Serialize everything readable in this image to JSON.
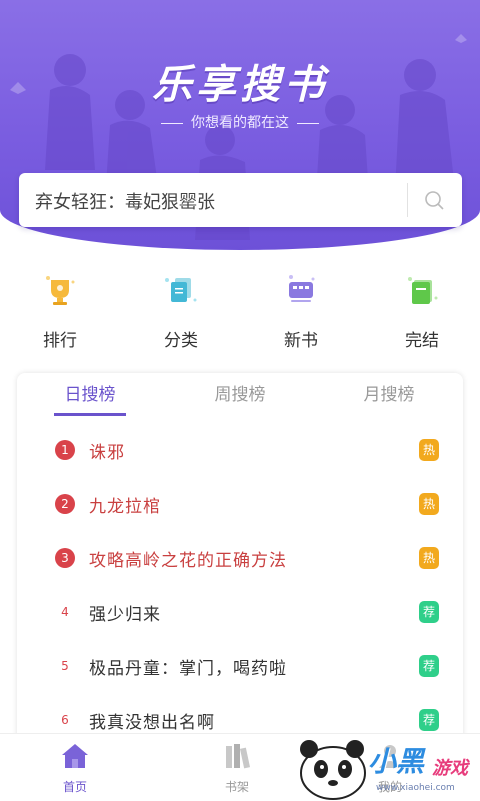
{
  "header": {
    "logo": "乐享搜书",
    "slogan": "你想看的都在这"
  },
  "search": {
    "placeholder": "弃女轻狂：毒妃狠罂张"
  },
  "categories": [
    {
      "label": "排行",
      "icon": "trophy-icon"
    },
    {
      "label": "分类",
      "icon": "category-icon"
    },
    {
      "label": "新书",
      "icon": "new-book-icon"
    },
    {
      "label": "完结",
      "icon": "finished-book-icon"
    }
  ],
  "tabs": [
    {
      "label": "日搜榜",
      "active": true
    },
    {
      "label": "周搜榜",
      "active": false
    },
    {
      "label": "月搜榜",
      "active": false
    }
  ],
  "rankings": [
    {
      "rank": "1",
      "title": "诛邪",
      "badge": "热"
    },
    {
      "rank": "2",
      "title": "九龙拉棺",
      "badge": "热"
    },
    {
      "rank": "3",
      "title": "攻略高岭之花的正确方法",
      "badge": "热"
    },
    {
      "rank": "4",
      "title": "强少归来",
      "badge": "荐"
    },
    {
      "rank": "5",
      "title": "极品丹童：掌门，喝药啦",
      "badge": "荐"
    },
    {
      "rank": "6",
      "title": "我真没想出名啊",
      "badge": "荐"
    }
  ],
  "bottom_nav": [
    {
      "label": "首页",
      "icon": "home-icon",
      "active": true
    },
    {
      "label": "书架",
      "icon": "bookshelf-icon",
      "active": false
    },
    {
      "label": "我的",
      "icon": "user-icon",
      "active": false
    }
  ],
  "watermark": {
    "text1": "小黑",
    "text2": "游戏",
    "url": "www.xiaohei.com"
  },
  "colors": {
    "accent": "#6a53cc",
    "hero": "#7a5de0",
    "top_rank": "#d9434a",
    "hot_badge": "#f2a91e",
    "rec_badge": "#2fcf8a"
  }
}
